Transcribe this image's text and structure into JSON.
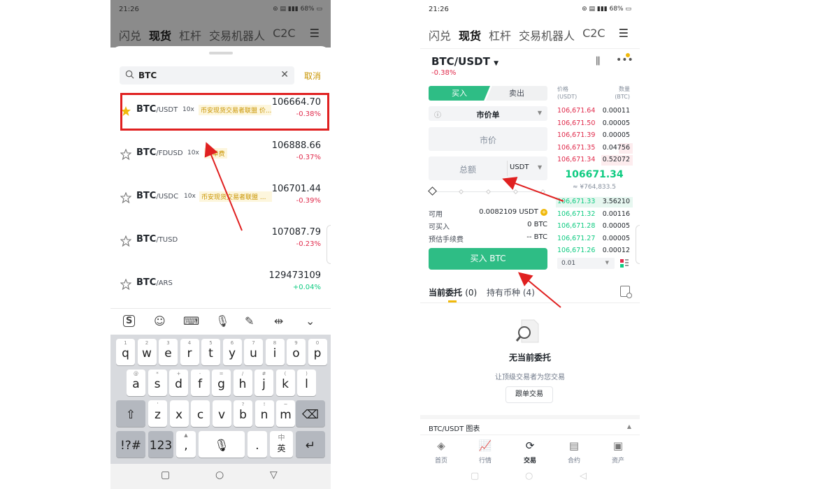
{
  "left": {
    "status_time": "21:26",
    "status_battery": "68%",
    "nav_tabs": [
      "闪兑",
      "现货",
      "杠杆",
      "交易机器人",
      "C2C"
    ],
    "search": {
      "value": "BTC",
      "cancel": "取消"
    },
    "coins": [
      {
        "base": "BTC",
        "quote": "/USDT",
        "leverage": "10x",
        "tag": "币安现货交易者联盟 价...",
        "price": "106664.70",
        "change": "-0.38%",
        "starred": true
      },
      {
        "base": "BTC",
        "quote": "/FDUSD",
        "leverage": "10x",
        "tag": "0 单费",
        "price": "106888.66",
        "change": "-0.37%",
        "starred": false
      },
      {
        "base": "BTC",
        "quote": "/USDC",
        "leverage": "10x",
        "tag": "币安现货交易者联盟 ...",
        "price": "106701.44",
        "change": "-0.39%",
        "starred": false
      },
      {
        "base": "BTC",
        "quote": "/TUSD",
        "leverage": "",
        "tag": "",
        "price": "107087.79",
        "change": "-0.23%",
        "starred": false
      },
      {
        "base": "BTC",
        "quote": "/ARS",
        "leverage": "",
        "tag": "",
        "price": "129473109",
        "change": "+0.04%",
        "starred": false
      }
    ],
    "keyboard": {
      "row1": [
        [
          "1",
          "q"
        ],
        [
          "2",
          "w"
        ],
        [
          "3",
          "e"
        ],
        [
          "4",
          "r"
        ],
        [
          "5",
          "t"
        ],
        [
          "6",
          "y"
        ],
        [
          "7",
          "u"
        ],
        [
          "8",
          "i"
        ],
        [
          "9",
          "o"
        ],
        [
          "0",
          "p"
        ]
      ],
      "row2": [
        [
          "@",
          "a"
        ],
        [
          "*",
          "s"
        ],
        [
          "+",
          "d"
        ],
        [
          "-",
          "f"
        ],
        [
          "=",
          "g"
        ],
        [
          "/",
          "h"
        ],
        [
          "#",
          "j"
        ],
        [
          "(",
          "k"
        ],
        [
          ")",
          "l"
        ]
      ],
      "row3": [
        [
          "'",
          "z"
        ],
        [
          "",
          "x"
        ],
        [
          "",
          "c"
        ],
        [
          "",
          "v"
        ],
        [
          "?",
          "b"
        ],
        [
          "!",
          "n"
        ],
        [
          "~",
          "m"
        ]
      ],
      "sym_key": "!?#",
      "num_key": "123",
      "comma_key": ",",
      "dot_key": ".",
      "lang_key_top": "中",
      "lang_key_bottom": "英"
    }
  },
  "right": {
    "status_time": "21:26",
    "status_battery": "68%",
    "nav_tabs": [
      "闪兑",
      "现货",
      "杠杆",
      "交易机器人",
      "C2C"
    ],
    "pair": "BTC/USDT",
    "pair_change": "-0.38%",
    "buy_tab": "买入",
    "sell_tab": "卖出",
    "order_type": "市价单",
    "price_placeholder": "市价",
    "total_placeholder": "总额",
    "total_unit": "USDT",
    "available_label": "可用",
    "available_value": "0.0082109 USDT",
    "can_buy_label": "可买入",
    "can_buy_value": "0 BTC",
    "fee_label": "预估手续费",
    "fee_value": "-- BTC",
    "buy_button": "买入 BTC",
    "orderbook": {
      "price_header": "价格",
      "price_unit": "(USDT)",
      "qty_header": "数量",
      "qty_unit": "(BTC)",
      "asks": [
        {
          "price": "106,671.64",
          "qty": "0.00011"
        },
        {
          "price": "106,671.50",
          "qty": "0.00005"
        },
        {
          "price": "106,671.39",
          "qty": "0.00005"
        },
        {
          "price": "106,671.35",
          "qty": "0.04756"
        },
        {
          "price": "106,671.34",
          "qty": "0.52072"
        }
      ],
      "last_price": "106671.34",
      "last_price_cny": "≈ ¥764,833.5",
      "bids": [
        {
          "price": "106,671.33",
          "qty": "3.56210"
        },
        {
          "price": "106,671.32",
          "qty": "0.00116"
        },
        {
          "price": "106,671.28",
          "qty": "0.00005"
        },
        {
          "price": "106,671.27",
          "qty": "0.00005"
        },
        {
          "price": "106,671.26",
          "qty": "0.00012"
        }
      ],
      "depth": "0.01"
    },
    "order_tabs": {
      "current": "当前委托",
      "current_count": "(0)",
      "holdings": "持有币种",
      "holdings_count": "(4)"
    },
    "empty_title": "无当前委托",
    "empty_sub": "让顶级交易者为您交易",
    "copy_trade": "跟单交易",
    "chart_bar": "BTC/USDT 图表",
    "bottom_nav": [
      "首页",
      "行情",
      "交易",
      "合约",
      "资产"
    ]
  },
  "colors": {
    "brand_yellow": "#f0b90b",
    "buy_green": "#2ebd85",
    "sell_red": "#e0294a",
    "highlight_red": "#e02020"
  }
}
